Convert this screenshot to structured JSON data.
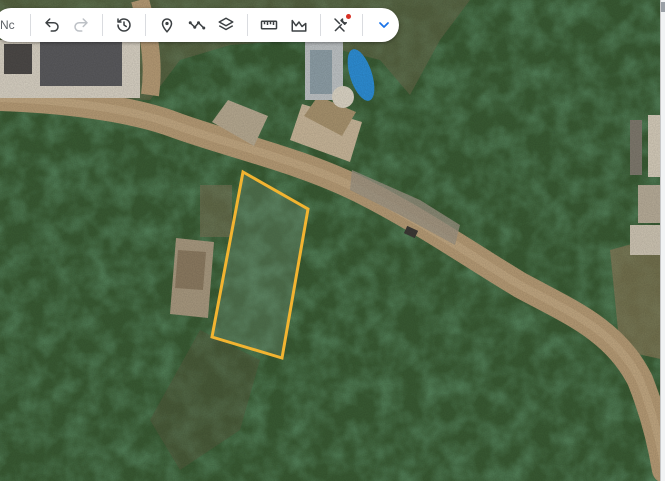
{
  "app": {
    "title_fragment": "Nc"
  },
  "toolbar": {
    "buttons": [
      {
        "id": "undo",
        "icon": "undo-icon"
      },
      {
        "id": "redo",
        "icon": "redo-icon"
      },
      {
        "id": "history",
        "icon": "history-icon"
      },
      {
        "id": "placemark",
        "icon": "placemark-icon"
      },
      {
        "id": "path",
        "icon": "path-icon"
      },
      {
        "id": "layers",
        "icon": "layers-icon"
      },
      {
        "id": "measure",
        "icon": "ruler-icon"
      },
      {
        "id": "elevation",
        "icon": "elevation-icon"
      },
      {
        "id": "tools",
        "icon": "tools-icon"
      },
      {
        "id": "more",
        "icon": "chevron-down-icon"
      }
    ],
    "accent_color": "#1a73e8",
    "notification_color": "#d93025"
  },
  "map": {
    "view": "satellite",
    "parcel_outline_color": "#f2b431"
  }
}
